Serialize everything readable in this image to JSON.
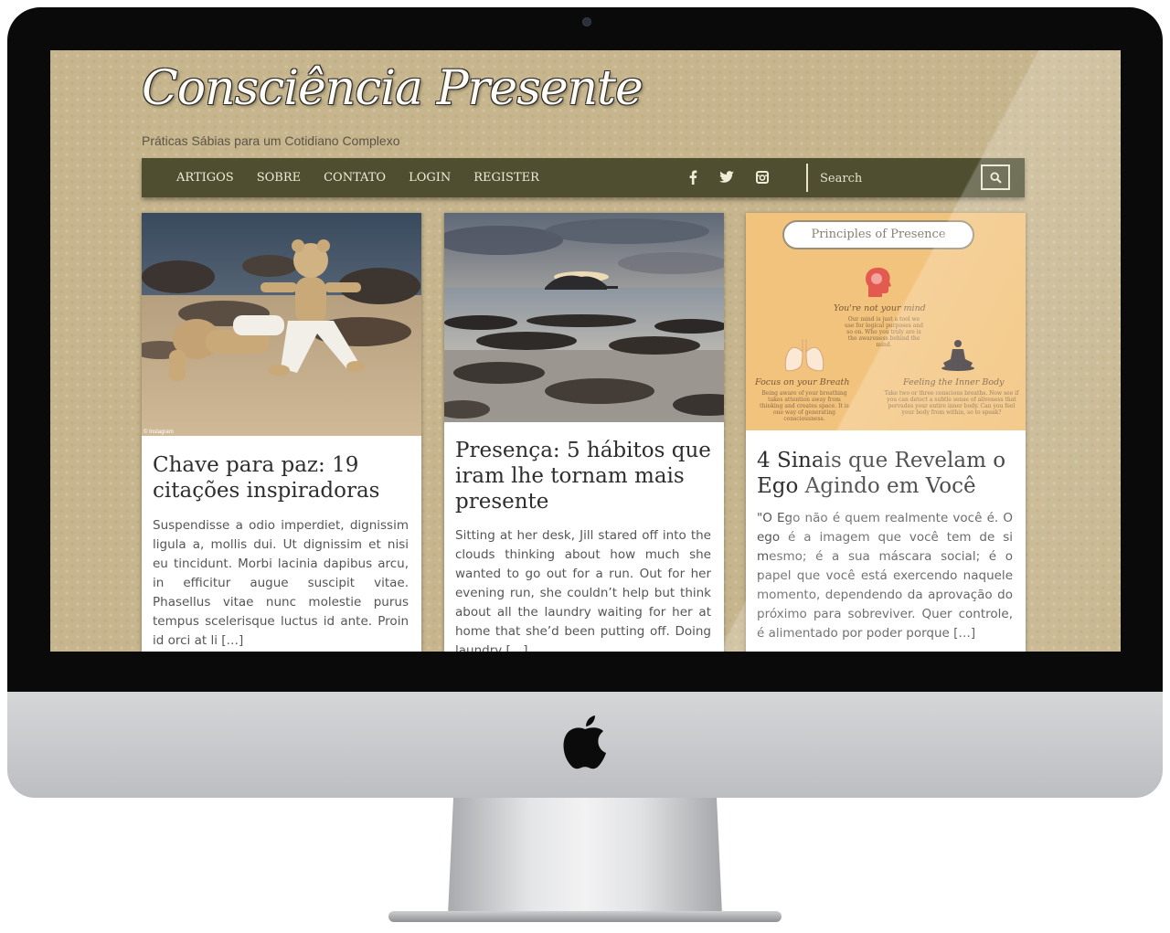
{
  "site": {
    "logo": "Consciência Presente",
    "tagline": "Práticas Sábias para um Cotidiano Complexo"
  },
  "nav": {
    "items": [
      {
        "label": "ARTIGOS"
      },
      {
        "label": "SOBRE"
      },
      {
        "label": "CONTATO"
      },
      {
        "label": "LOGIN"
      },
      {
        "label": "REGISTER"
      }
    ],
    "social": [
      "facebook-icon",
      "twitter-icon",
      "instagram-icon"
    ],
    "search_placeholder": "Search"
  },
  "posts": [
    {
      "title": "Chave para paz: 19 citações inspiradoras",
      "excerpt": "Suspendisse a odio imperdiet, dignissim ligula a, mollis dui. Ut dignissim et nisi eu tincidunt. Morbi lacinia dapibus arcu, in efficitur augue suscipit vitae. Phasellus vitae nunc molestie purus tempus scelerisque luctus id ante. Proin id orci at li […]",
      "image_credit": "© Instagram"
    },
    {
      "title": "Presença: 5 hábitos que iram lhe tornam mais presente",
      "excerpt": "Sitting at her desk, Jill stared off into the clouds thinking about how much she wanted to go out for a run. Out for her evening run, she couldn’t help but think about all the laundry waiting for her at home that she’d been putting off. Doing laundry […]"
    },
    {
      "title": "4 Sinais que Revelam o Ego Agindo em Você",
      "excerpt": "\"O Ego não é quem realmente você é. O ego é a imagem que você tem de si mesmo; é a sua máscara social; é o papel que você está exercendo naquele momento, dependendo da aprovação do próximo para sobreviver. Quer controle, é alimentado por poder porque […]",
      "infographic": {
        "title": "Principles of Presence",
        "mind_heading": "You're not your mind",
        "mind_text": "Our mind is just a tool we use for logical purposes and so on. Who you truly are is the awareness behind the mind.",
        "breath_heading": "Focus on your Breath",
        "breath_text": "Being aware of your breathing takes attention away from thinking and creates space. It is one way of generating consciousness.",
        "body_heading": "Feeling the Inner Body",
        "body_text": "Take two or three conscious breaths. Now see if you can detect a subtle sense of aliveness that pervades your entire inner body. Can you feel your body from within, so to speak?"
      }
    }
  ]
}
